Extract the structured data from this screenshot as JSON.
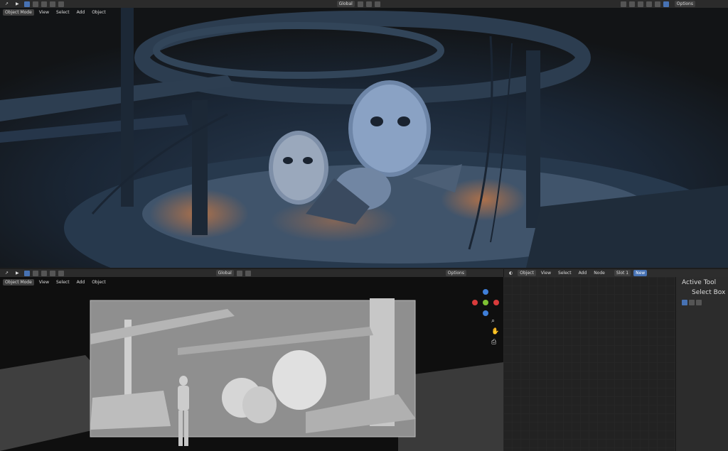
{
  "top_header": {
    "mode": "Object Mode",
    "menus": [
      "View",
      "Select",
      "Add",
      "Object"
    ],
    "transform": "Global",
    "options": "Options"
  },
  "bottom_header": {
    "mode": "Object Mode",
    "menus": [
      "View",
      "Select",
      "Add",
      "Object"
    ],
    "transform": "Global",
    "options": "Options"
  },
  "node_header": {
    "context": "Object",
    "menus": [
      "View",
      "Select",
      "Add",
      "Node"
    ],
    "slot": "Slot 1",
    "new_label": "New"
  },
  "tool_panel": {
    "title": "Active Tool",
    "tool_name": "Select Box"
  },
  "colors": {
    "header_bg": "#2b2b2b",
    "accent_blue": "#4772b3",
    "axis_x": "#d93b3b",
    "axis_y": "#7ec133",
    "axis_z": "#3f7fd9"
  },
  "icons": {
    "editor_type": "cursor-icon",
    "viewport_gizmo": "navigation-gizmo-icon",
    "zoom": "zoom-icon",
    "hand": "hand-icon",
    "camera": "camera-icon"
  }
}
